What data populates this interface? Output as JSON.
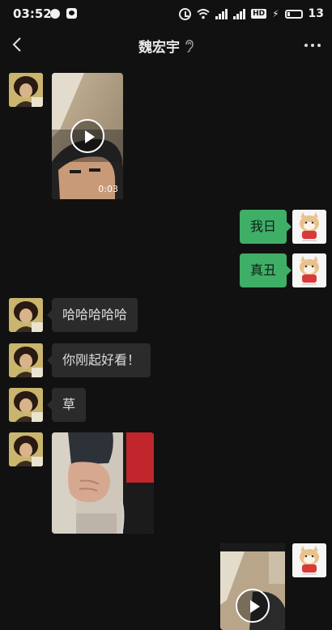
{
  "status_bar": {
    "time": "03:52",
    "battery": "13",
    "hd_label": "HD"
  },
  "header": {
    "title": "魏宏宇"
  },
  "messages": {
    "m1_video_duration": "0:03",
    "m2_text": "我日",
    "m3_text": "真丑",
    "m4_text": "哈哈哈哈哈",
    "m5_text": "你刚起好看！",
    "m6_text": "草"
  },
  "colors": {
    "background": "#111111",
    "sent_bubble": "#3fae67",
    "received_bubble": "#2b2b2b"
  },
  "icons": [
    "back-arrow-icon",
    "ear-icon",
    "more-icon",
    "play-icon",
    "alarm-icon",
    "signal-icon",
    "battery-icon",
    "wifi-icon"
  ]
}
